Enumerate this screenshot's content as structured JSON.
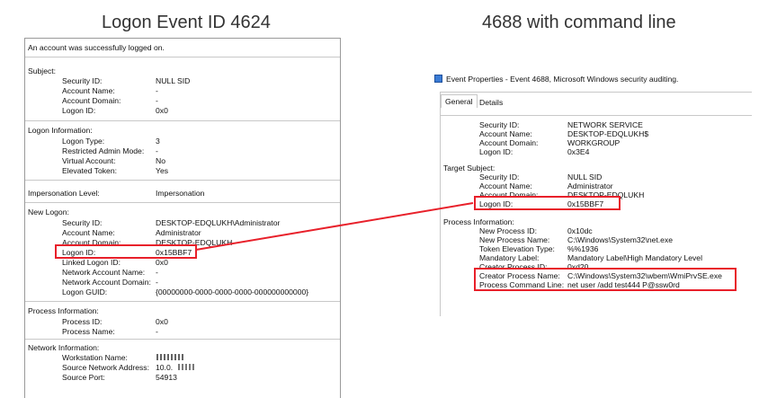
{
  "headings": {
    "left": "Logon Event ID 4624",
    "right": "4688 with command line"
  },
  "left": {
    "intro": "An account was successfully logged on.",
    "subject": {
      "title": "Subject:",
      "rows": [
        [
          "Security ID:",
          "NULL SID"
        ],
        [
          "Account Name:",
          "-"
        ],
        [
          "Account Domain:",
          "-"
        ],
        [
          "Logon ID:",
          "0x0"
        ]
      ]
    },
    "logon_info": {
      "title": "Logon Information:",
      "rows": [
        [
          "Logon Type:",
          "3"
        ],
        [
          "Restricted Admin Mode:",
          "-"
        ],
        [
          "Virtual Account:",
          "No"
        ],
        [
          "Elevated Token:",
          "Yes"
        ]
      ]
    },
    "impersonation": [
      "Impersonation Level:",
      "Impersonation"
    ],
    "new_logon": {
      "title": "New Logon:",
      "rows": [
        [
          "Security ID:",
          "DESKTOP-EDQLUKH\\Administrator"
        ],
        [
          "Account Name:",
          "Administrator"
        ],
        [
          "Account Domain:",
          "DESKTOP-EDQLUKH"
        ],
        [
          "Logon ID:",
          "0x15BBF7"
        ],
        [
          "Linked Logon ID:",
          "0x0"
        ],
        [
          "Network Account Name:",
          "-"
        ],
        [
          "Network Account Domain:",
          "-"
        ],
        [
          "Logon GUID:",
          "{00000000-0000-0000-0000-000000000000}"
        ]
      ]
    },
    "process_info": {
      "title": "Process Information:",
      "rows": [
        [
          "Process ID:",
          "0x0"
        ],
        [
          "Process Name:",
          "-"
        ]
      ]
    },
    "network_info": {
      "title": "Network Information:",
      "rows": [
        [
          "Workstation Name:",
          ""
        ],
        [
          "Source Network Address:",
          "10.0."
        ],
        [
          "Source Port:",
          "54913"
        ]
      ]
    }
  },
  "right": {
    "window_title": "Event Properties - Event 4688, Microsoft Windows security auditing.",
    "tabs": [
      "General",
      "Details"
    ],
    "subject_rows": [
      [
        "Security ID:",
        "NETWORK SERVICE"
      ],
      [
        "Account Name:",
        "DESKTOP-EDQLUKH$"
      ],
      [
        "Account Domain:",
        "WORKGROUP"
      ],
      [
        "Logon ID:",
        "0x3E4"
      ]
    ],
    "target_subject": {
      "title": "Target Subject:",
      "rows": [
        [
          "Security ID:",
          "NULL SID"
        ],
        [
          "Account Name:",
          "Administrator"
        ],
        [
          "Account Domain:",
          "DESKTOP-EDQLUKH"
        ],
        [
          "Logon ID:",
          "0x15BBF7"
        ]
      ]
    },
    "process_info": {
      "title": "Process Information:",
      "rows": [
        [
          "New Process ID:",
          "0x10dc"
        ],
        [
          "New Process Name:",
          "C:\\Windows\\System32\\net.exe"
        ],
        [
          "Token Elevation Type:",
          "%%1936"
        ],
        [
          "Mandatory Label:",
          "Mandatory Label\\High Mandatory Level"
        ],
        [
          "Creator Process ID:",
          "0xd20"
        ],
        [
          "Creator Process Name:",
          "C:\\Windows\\System32\\wbem\\WmiPrvSE.exe"
        ],
        [
          "Process Command Line:",
          "net user /add test444 P@ssw0rd"
        ]
      ]
    }
  },
  "colors": {
    "highlight": "#e8202a"
  }
}
